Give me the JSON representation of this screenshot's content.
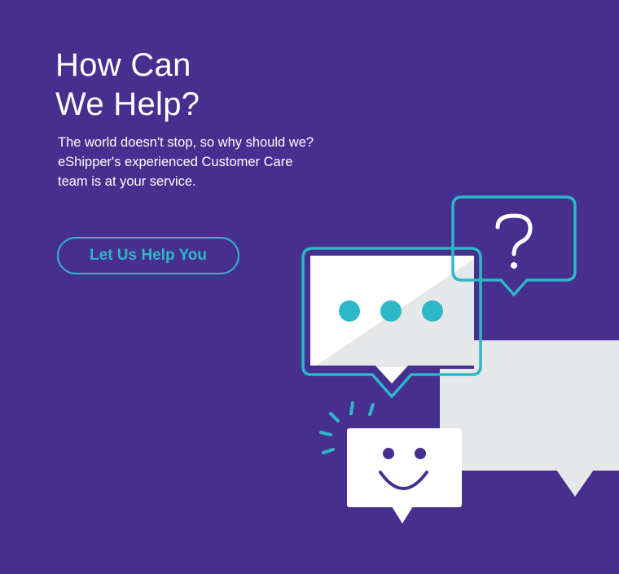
{
  "hero": {
    "title_line1": "How Can",
    "title_line2": "We Help?",
    "description": "The world doesn't stop, so why should we? eShipper's experienced Customer Care team is at your service.",
    "cta_label": "Let Us Help You"
  },
  "illustration": {
    "icons": [
      "ellipsis-speech-bubble-icon",
      "question-speech-bubble-icon",
      "smiley-speech-bubble-icon",
      "blank-speech-bubble-icon"
    ],
    "question_mark": "?"
  },
  "colors": {
    "background": "#472f8f",
    "accent": "#2cb8c6",
    "bubble_light": "#e6e7e8",
    "white": "#ffffff"
  }
}
